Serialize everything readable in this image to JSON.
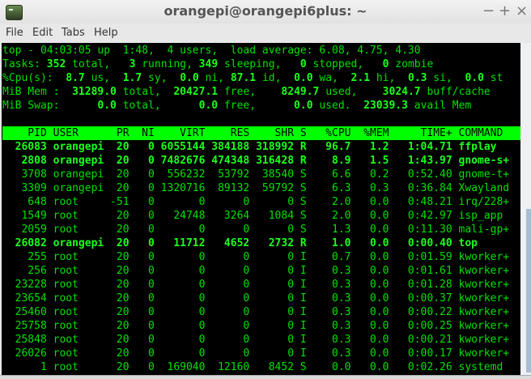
{
  "window": {
    "title": "orangepi@orangepi6plus: ~",
    "minimize": "−",
    "maximize": "+",
    "close": "×"
  },
  "menu": [
    "File",
    "Edit",
    "Tabs",
    "Help"
  ],
  "summary": [
    [
      [
        "top - 04:03:05 up  1:48,  4 users,  load average: 6.08, 4.75, 4.30",
        false
      ]
    ],
    [
      [
        "Tasks: ",
        false
      ],
      [
        "352",
        true
      ],
      [
        " total,   ",
        false
      ],
      [
        "3",
        true
      ],
      [
        " running, ",
        false
      ],
      [
        "349",
        true
      ],
      [
        " sleeping,   ",
        false
      ],
      [
        "0",
        true
      ],
      [
        " stopped,   ",
        false
      ],
      [
        "0",
        true
      ],
      [
        " zombie",
        false
      ]
    ],
    [
      [
        "%Cpu(s):  ",
        false
      ],
      [
        "8.7",
        true
      ],
      [
        " us,  ",
        false
      ],
      [
        "1.7",
        true
      ],
      [
        " sy,  ",
        false
      ],
      [
        "0.0",
        true
      ],
      [
        " ni, ",
        false
      ],
      [
        "87.1",
        true
      ],
      [
        " id,  ",
        false
      ],
      [
        "0.0",
        true
      ],
      [
        " wa,  ",
        false
      ],
      [
        "2.1",
        true
      ],
      [
        " hi,  ",
        false
      ],
      [
        "0.3",
        true
      ],
      [
        " si,  ",
        false
      ],
      [
        "0.0",
        true
      ],
      [
        " st",
        false
      ]
    ],
    [
      [
        "MiB Mem :  ",
        false
      ],
      [
        "31289.0",
        true
      ],
      [
        " total,  ",
        false
      ],
      [
        "20427.1",
        true
      ],
      [
        " free,    ",
        false
      ],
      [
        "8249.7",
        true
      ],
      [
        " used,    ",
        false
      ],
      [
        "3024.7",
        true
      ],
      [
        " buff/cache",
        false
      ]
    ],
    [
      [
        "MiB Swap:      ",
        false
      ],
      [
        "0.0",
        true
      ],
      [
        " total,      ",
        false
      ],
      [
        "0.0",
        true
      ],
      [
        " free,      ",
        false
      ],
      [
        "0.0",
        true
      ],
      [
        " used.  ",
        false
      ],
      [
        "23039.3",
        true
      ],
      [
        " avail Mem",
        false
      ]
    ]
  ],
  "columns": [
    "PID",
    "USER",
    "PR",
    "NI",
    "VIRT",
    "RES",
    "SHR",
    "S",
    "%CPU",
    "%MEM",
    "TIME+",
    "COMMAND"
  ],
  "processes": [
    [
      "26083",
      "orangepi",
      "20",
      "0",
      "6055144",
      "384188",
      "318992",
      "R",
      "96.7",
      "1.2",
      "1:04.71",
      "ffplay"
    ],
    [
      "2808",
      "orangepi",
      "20",
      "0",
      "7482676",
      "474348",
      "316428",
      "R",
      "8.9",
      "1.5",
      "1:43.97",
      "gnome-s+"
    ],
    [
      "3708",
      "orangepi",
      "20",
      "0",
      "556232",
      "53792",
      "38540",
      "S",
      "6.6",
      "0.2",
      "0:52.40",
      "gnome-t+"
    ],
    [
      "3309",
      "orangepi",
      "20",
      "0",
      "1320716",
      "89132",
      "59792",
      "S",
      "6.3",
      "0.3",
      "0:36.84",
      "Xwayland"
    ],
    [
      "648",
      "root",
      "-51",
      "0",
      "0",
      "0",
      "0",
      "S",
      "2.0",
      "0.0",
      "0:48.21",
      "irq/228+"
    ],
    [
      "1549",
      "root",
      "20",
      "0",
      "24748",
      "3264",
      "1084",
      "S",
      "2.0",
      "0.0",
      "0:42.97",
      "isp_app"
    ],
    [
      "2059",
      "root",
      "20",
      "0",
      "0",
      "0",
      "0",
      "S",
      "1.3",
      "0.0",
      "0:11.30",
      "mali-gp+"
    ],
    [
      "26082",
      "orangepi",
      "20",
      "0",
      "11712",
      "4652",
      "2732",
      "R",
      "1.0",
      "0.0",
      "0:00.40",
      "top"
    ],
    [
      "255",
      "root",
      "20",
      "0",
      "0",
      "0",
      "0",
      "I",
      "0.7",
      "0.0",
      "0:01.59",
      "kworker+"
    ],
    [
      "256",
      "root",
      "20",
      "0",
      "0",
      "0",
      "0",
      "I",
      "0.3",
      "0.0",
      "0:01.61",
      "kworker+"
    ],
    [
      "23228",
      "root",
      "20",
      "0",
      "0",
      "0",
      "0",
      "I",
      "0.3",
      "0.0",
      "0:01.28",
      "kworker+"
    ],
    [
      "23654",
      "root",
      "20",
      "0",
      "0",
      "0",
      "0",
      "I",
      "0.3",
      "0.0",
      "0:00.37",
      "kworker+"
    ],
    [
      "25460",
      "root",
      "20",
      "0",
      "0",
      "0",
      "0",
      "I",
      "0.3",
      "0.0",
      "0:00.22",
      "kworker+"
    ],
    [
      "25758",
      "root",
      "20",
      "0",
      "0",
      "0",
      "0",
      "I",
      "0.3",
      "0.0",
      "0:00.25",
      "kworker+"
    ],
    [
      "25848",
      "root",
      "20",
      "0",
      "0",
      "0",
      "0",
      "I",
      "0.3",
      "0.0",
      "0:00.21",
      "kworker+"
    ],
    [
      "26026",
      "root",
      "20",
      "0",
      "0",
      "0",
      "0",
      "I",
      "0.3",
      "0.0",
      "0:00.17",
      "kworker+"
    ],
    [
      "1",
      "root",
      "20",
      "0",
      "169040",
      "12160",
      "8452",
      "S",
      "0.0",
      "0.0",
      "0:02.26",
      "systemd"
    ]
  ]
}
